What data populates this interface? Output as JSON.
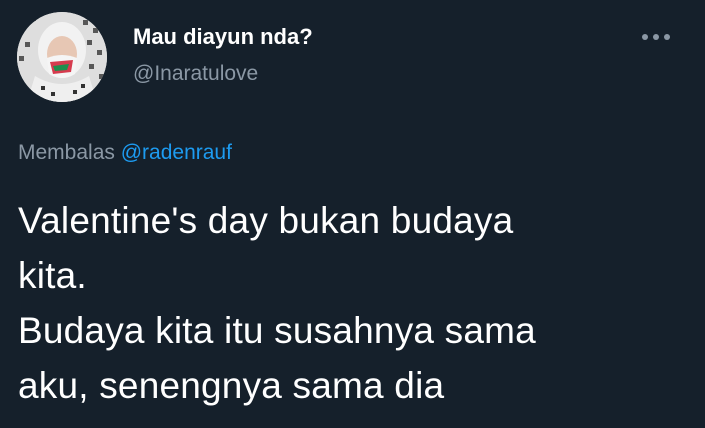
{
  "author": {
    "display_name": "Mau diayun nda?",
    "handle": "@Inaratulove"
  },
  "reply": {
    "prefix": "Membalas",
    "mention": "@radenrauf"
  },
  "tweet": {
    "lines": [
      "Valentine's day bukan budaya",
      "kita.",
      "Budaya kita itu susahnya sama",
      "aku, senengnya sama dia"
    ]
  },
  "icons": {
    "more": "more-horizontal-icon"
  },
  "colors": {
    "background": "#15202b",
    "text_primary": "#ffffff",
    "text_secondary": "#8b98a5",
    "accent": "#1d9bf0"
  }
}
